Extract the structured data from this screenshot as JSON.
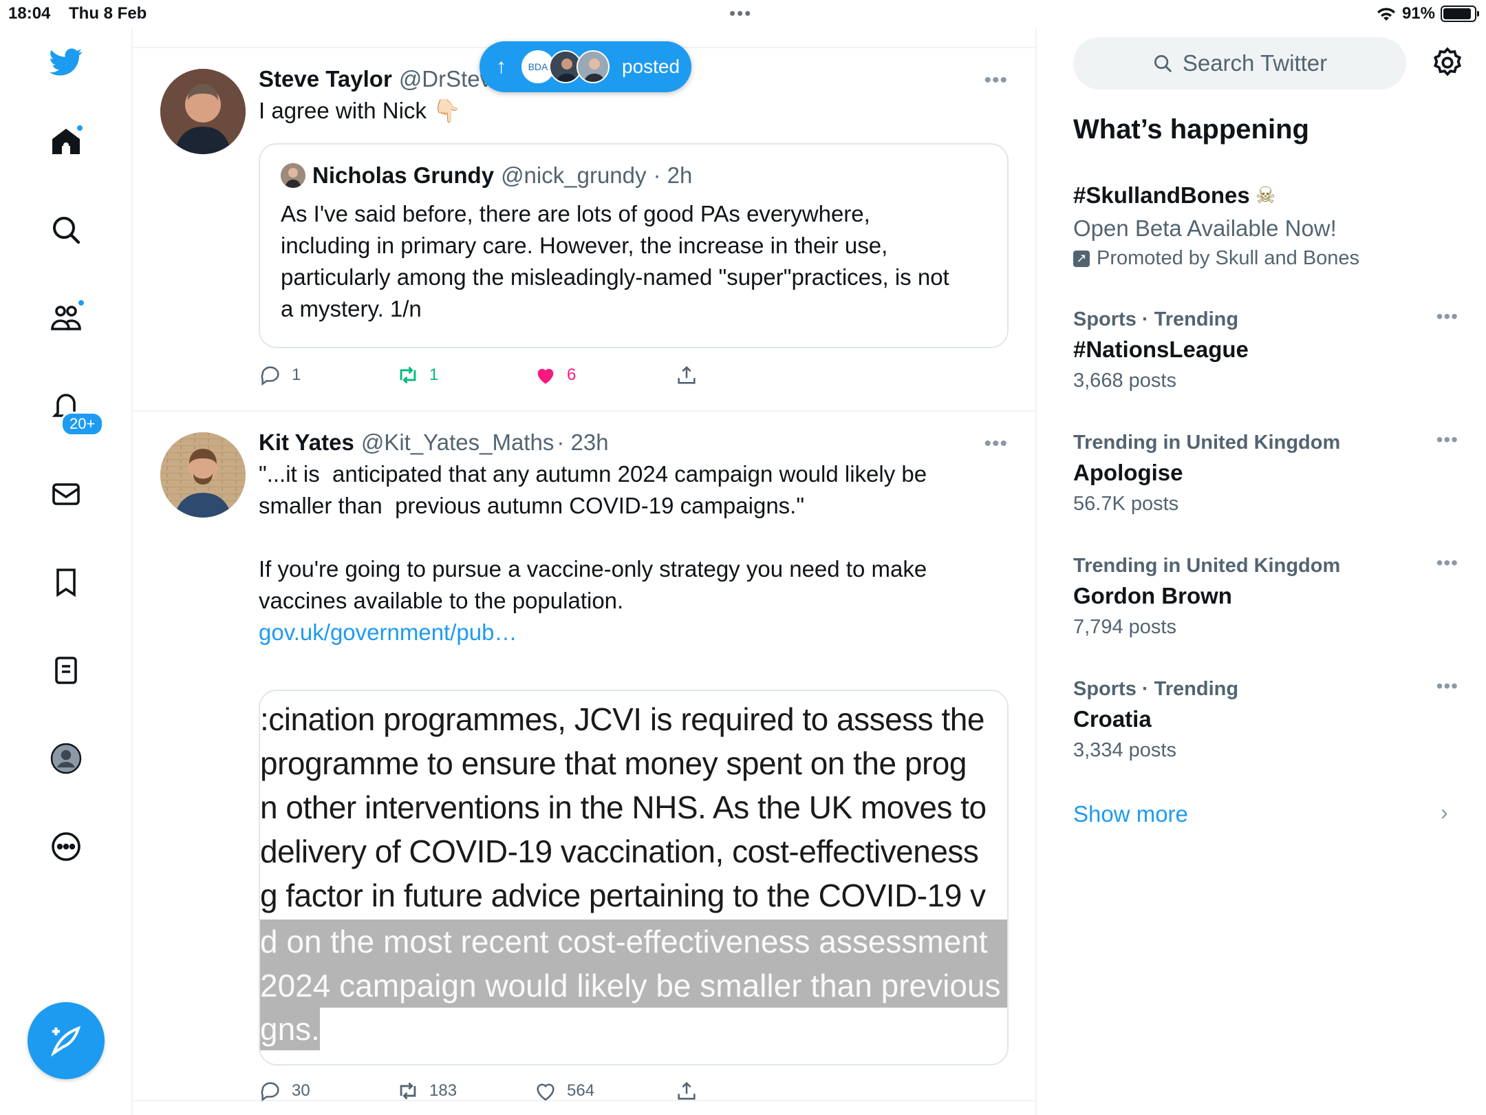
{
  "status_bar": {
    "time": "18:04",
    "date": "Thu 8 Feb",
    "battery": "91%",
    "battery_level": 0.91
  },
  "nav": {
    "notifications_badge": "20+",
    "icons": [
      "twitter-logo",
      "home-icon",
      "search-icon",
      "communities-icon",
      "bell-icon",
      "mail-icon",
      "bookmark-icon",
      "lists-icon",
      "profile-icon",
      "more-icon",
      "compose-icon"
    ]
  },
  "posted_pill": {
    "label": "posted",
    "avatar_text": "BDA"
  },
  "tweets": [
    {
      "name": "Steve Taylor",
      "handle": "@DrStev",
      "text": "I agree with Nick 👇🏻",
      "quote": {
        "name": "Nicholas Grundy",
        "handle": "@nick_grundy",
        "time": "· 2h",
        "text": "As I've said before, there are lots of good PAs everywhere,\nincluding in primary care. However, the increase in their use,\nparticularly among the misleadingly-named \"super\"practices, is not\na mystery. 1/n"
      },
      "replies": "1",
      "retweets": "1",
      "likes": "6",
      "liked": true
    },
    {
      "name": "Kit Yates",
      "handle": "@Kit_Yates_Maths",
      "time": "· 23h",
      "text": "\"...it is  anticipated that any autumn 2024 campaign would likely be\nsmaller than  previous autumn COVID-19 campaigns.\"\n\nIf you're going to pursue a vaccine-only strategy you need to make\nvaccines available to the population.",
      "link": "gov.uk/government/pub…",
      "media_lines": [
        ":cination programmes, JCVI is required to assess the",
        " programme to ensure that money spent on the prog",
        "n other interventions in the NHS. As the UK moves to",
        " delivery of COVID-19 vaccination, cost-effectiveness",
        "g factor in future advice pertaining to the COVID-19 v"
      ],
      "media_highlight_lines": [
        "d on the most recent cost-effectiveness assessment",
        "2024 campaign would likely be smaller than previous",
        "gns."
      ],
      "replies": "30",
      "retweets": "183",
      "likes": "564",
      "liked": false
    }
  ],
  "sidebar": {
    "search_placeholder": "Search Twitter",
    "title": "What’s happening",
    "promoted": {
      "title": "#SkullandBones",
      "emoji": "☠",
      "subtitle": "Open Beta Available Now!",
      "by": "Promoted by Skull and Bones"
    },
    "trends": [
      {
        "context": "Sports · Trending",
        "name": "#NationsLeague",
        "count": "3,668 posts"
      },
      {
        "context": "Trending in United Kingdom",
        "name": "Apologise",
        "count": "56.7K posts"
      },
      {
        "context": "Trending in United Kingdom",
        "name": "Gordon Brown",
        "count": "7,794 posts"
      },
      {
        "context": "Sports · Trending",
        "name": "Croatia",
        "count": "3,334 posts"
      }
    ],
    "show_more": "Show more"
  },
  "colors": {
    "accent": "#1d9bf0",
    "like": "#f91880",
    "retweet_active": "#00ba7c",
    "secondary_text": "#536471"
  }
}
